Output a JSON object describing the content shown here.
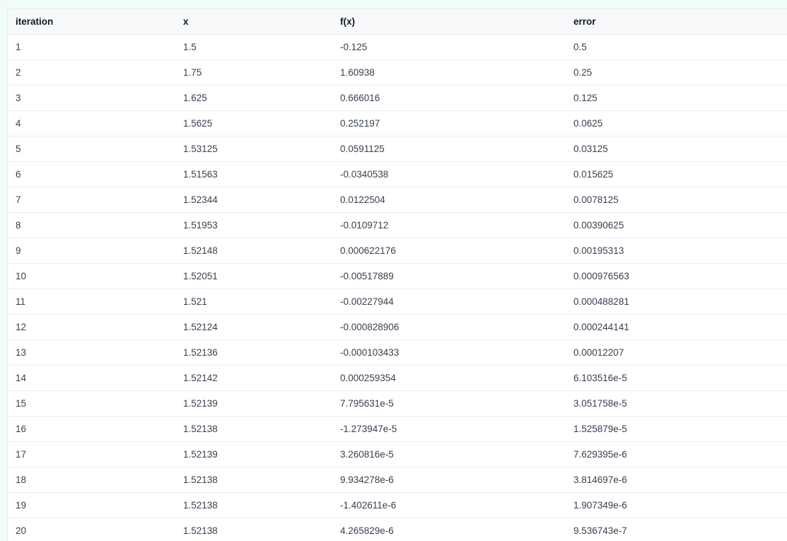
{
  "table": {
    "headers": [
      "iteration",
      "x",
      "f(x)",
      "error"
    ],
    "rows": [
      [
        "1",
        "1.5",
        "-0.125",
        "0.5"
      ],
      [
        "2",
        "1.75",
        "1.60938",
        "0.25"
      ],
      [
        "3",
        "1.625",
        "0.666016",
        "0.125"
      ],
      [
        "4",
        "1.5625",
        "0.252197",
        "0.0625"
      ],
      [
        "5",
        "1.53125",
        "0.0591125",
        "0.03125"
      ],
      [
        "6",
        "1.51563",
        "-0.0340538",
        "0.015625"
      ],
      [
        "7",
        "1.52344",
        "0.0122504",
        "0.0078125"
      ],
      [
        "8",
        "1.51953",
        "-0.0109712",
        "0.00390625"
      ],
      [
        "9",
        "1.52148",
        "0.000622176",
        "0.00195313"
      ],
      [
        "10",
        "1.52051",
        "-0.00517889",
        "0.000976563"
      ],
      [
        "11",
        "1.521",
        "-0.00227944",
        "0.000488281"
      ],
      [
        "12",
        "1.52124",
        "-0.000828906",
        "0.000244141"
      ],
      [
        "13",
        "1.52136",
        "-0.000103433",
        "0.00012207"
      ],
      [
        "14",
        "1.52142",
        "0.000259354",
        "6.103516e-5"
      ],
      [
        "15",
        "1.52139",
        "7.795631e-5",
        "3.051758e-5"
      ],
      [
        "16",
        "1.52138",
        "-1.273947e-5",
        "1.525879e-5"
      ],
      [
        "17",
        "1.52139",
        "3.260816e-5",
        "7.629395e-6"
      ],
      [
        "18",
        "1.52138",
        "9.934278e-6",
        "3.814697e-6"
      ],
      [
        "19",
        "1.52138",
        "-1.402611e-6",
        "1.907349e-6"
      ],
      [
        "20",
        "1.52138",
        "4.265829e-6",
        "9.536743e-7"
      ]
    ]
  },
  "colors": {
    "page_background": "#f0fdf6",
    "header_background": "#f8f9fb",
    "header_text": "#111827",
    "cell_text": "#374151",
    "row_border": "#eceef1"
  }
}
